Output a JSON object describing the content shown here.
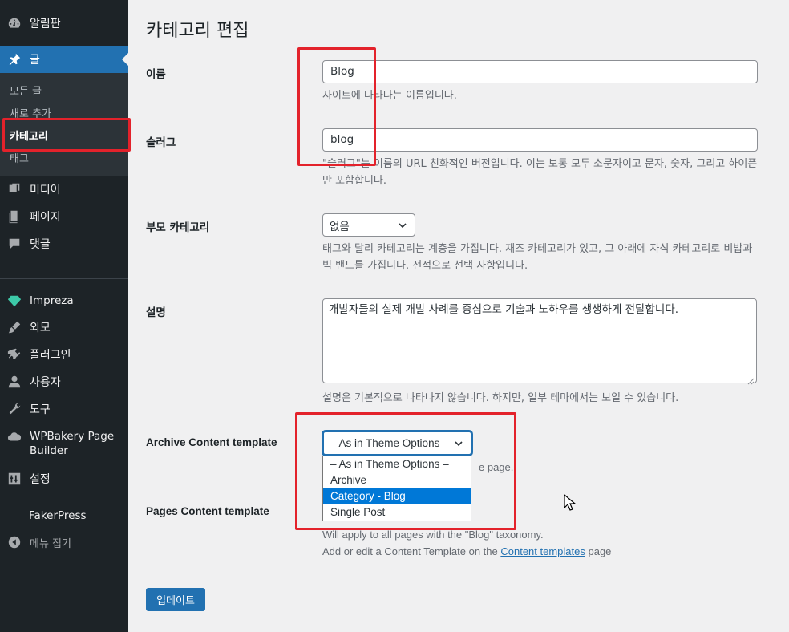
{
  "sidebar": {
    "items": [
      {
        "label": "알림판",
        "icon": "dashboard-icon"
      },
      {
        "label": "글",
        "icon": "pin-icon"
      },
      {
        "label": "미디어",
        "icon": "media-icon"
      },
      {
        "label": "페이지",
        "icon": "page-icon"
      },
      {
        "label": "댓글",
        "icon": "comment-icon"
      },
      {
        "label": "Impreza",
        "icon": "diamond-icon"
      },
      {
        "label": "외모",
        "icon": "brush-icon"
      },
      {
        "label": "플러그인",
        "icon": "plugin-icon"
      },
      {
        "label": "사용자",
        "icon": "user-icon"
      },
      {
        "label": "도구",
        "icon": "wrench-icon"
      },
      {
        "label": "WPBakery Page Builder",
        "icon": "cloud-icon"
      },
      {
        "label": "설정",
        "icon": "settings-icon"
      },
      {
        "label": "FakerPress",
        "icon": ""
      },
      {
        "label": "메뉴 접기",
        "icon": "collapse-icon"
      }
    ],
    "submenu": [
      "모든 글",
      "새로 추가",
      "카테고리",
      "태그"
    ]
  },
  "page": {
    "title": "카테고리 편집",
    "name_label": "이름",
    "name_value": "Blog",
    "name_hint": "사이트에 나타나는 이름입니다.",
    "slug_label": "슬러그",
    "slug_value": "blog",
    "slug_hint": "\"슬러그\"는 이름의 URL 친화적인 버전입니다. 이는 보통 모두 소문자이고 문자, 숫자, 그리고 하이픈만 포함합니다.",
    "parent_label": "부모 카테고리",
    "parent_value": "없음",
    "parent_hint": "태그와 달리 카테고리는 계층을 가집니다. 재즈 카테고리가 있고, 그 아래에 자식 카테고리로 비밥과 빅 밴드를 가집니다. 전적으로 선택 사항입니다.",
    "desc_label": "설명",
    "desc_value": "개발자들의 실제 개발 사례를 중심으로 기술과 노하우를 생생하게 전달합니다.",
    "desc_hint": "설명은 기본적으로 나타나지 않습니다. 하지만, 일부 테마에서는 보일 수 있습니다.",
    "archive_label": "Archive Content template",
    "archive_value": "– As in Theme Options –",
    "archive_hint_tail": "e page.",
    "archive_options": [
      "– As in Theme Options –",
      "Archive",
      "Category - Blog",
      "Single Post"
    ],
    "archive_selected_index": 2,
    "pages_label": "Pages Content template",
    "pages_hint_1": "Will apply to all pages with the \"Blog\" taxonomy.",
    "pages_hint_2a": "Add or edit a Content Template on the ",
    "pages_hint_link": "Content templates",
    "pages_hint_2b": " page",
    "update_label": "업데이트"
  },
  "colors": {
    "annotation": "#e3222b",
    "accent": "#2271b1",
    "sidebar_bg": "#1d2327"
  }
}
